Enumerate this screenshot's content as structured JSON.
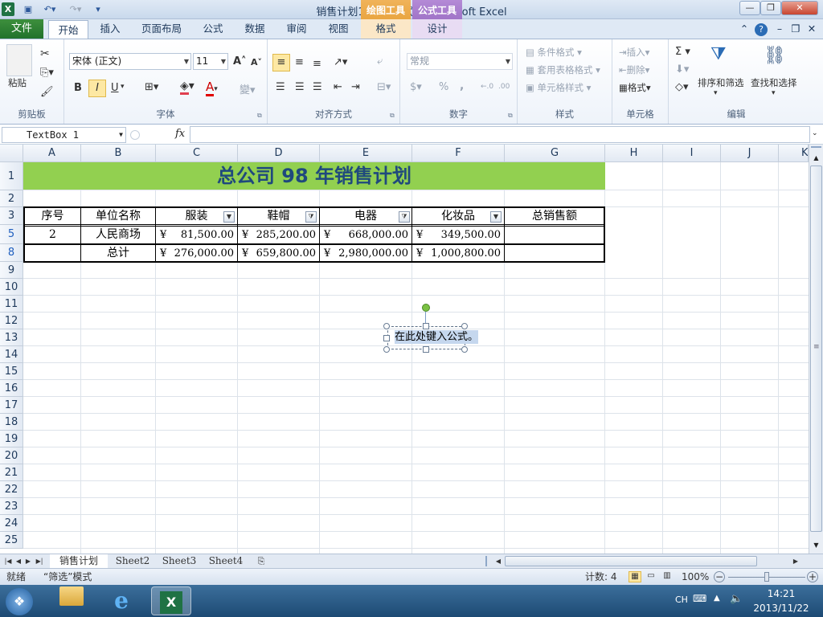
{
  "window": {
    "title": "销售计划1  [兼容模式]  -  Microsoft Excel",
    "context_tab_drawing": "绘图工具",
    "context_tab_formula": "公式工具",
    "minimize": "—",
    "restore": "❐",
    "close": "✕"
  },
  "tabs": {
    "file": "文件",
    "items": [
      "开始",
      "插入",
      "页面布局",
      "公式",
      "数据",
      "审阅",
      "视图",
      "格式",
      "设计"
    ]
  },
  "ribbon": {
    "clipboard": {
      "label": "剪贴板",
      "paste": "粘贴"
    },
    "font": {
      "label": "字体",
      "family": "宋体 (正文)",
      "size": "11",
      "bold": "B",
      "italic": "I",
      "underline": "U"
    },
    "alignment": {
      "label": "对齐方式"
    },
    "number": {
      "label": "数字",
      "format": "常规",
      "percent": "%",
      "comma": ","
    },
    "styles": {
      "label": "样式",
      "conditional": "条件格式",
      "table": "套用表格格式",
      "cell": "单元格样式"
    },
    "cells": {
      "label": "单元格",
      "insert": "插入",
      "delete": "删除",
      "format": "格式"
    },
    "editing": {
      "label": "编辑",
      "sort": "排序和筛选",
      "find": "查找和选择",
      "sum": "Σ"
    }
  },
  "formula_bar": {
    "name_box": "TextBox 1",
    "fx": "fx",
    "value": ""
  },
  "sheet": {
    "columns": [
      "A",
      "B",
      "C",
      "D",
      "E",
      "F",
      "G",
      "H",
      "I",
      "J",
      "K"
    ],
    "row_numbers": [
      "1",
      "2",
      "3",
      "5",
      "8",
      "9",
      "10",
      "11",
      "12",
      "13",
      "14",
      "15",
      "16",
      "17",
      "18",
      "19",
      "20",
      "21",
      "22",
      "23",
      "24",
      "25"
    ],
    "title": "总公司  98  年销售计划",
    "header_row": [
      "序号",
      "单位名称",
      "服装",
      "鞋帽",
      "电器",
      "化妆品",
      "总销售额"
    ],
    "row5": {
      "seq": "2",
      "unit": "人民商场",
      "values": [
        "81,500.00",
        "285,200.00",
        "668,000.00",
        "349,500.00"
      ]
    },
    "row8": {
      "unit": "总计",
      "values": [
        "276,000.00",
        "659,800.00",
        "2,980,000.00",
        "1,000,800.00"
      ]
    },
    "currency": "¥",
    "textbox": "在此处键入公式。",
    "title_fill": "#92d050",
    "title_color": "#1f497d"
  },
  "sheet_tabs": [
    "销售计划",
    "Sheet2",
    "Sheet3",
    "Sheet4"
  ],
  "status": {
    "ready": "就绪",
    "mode": "“筛选”模式",
    "count": "计数: 4",
    "zoom": "100%"
  },
  "taskbar": {
    "lang": "CH",
    "time": "14:21",
    "date": "2013/11/22"
  }
}
